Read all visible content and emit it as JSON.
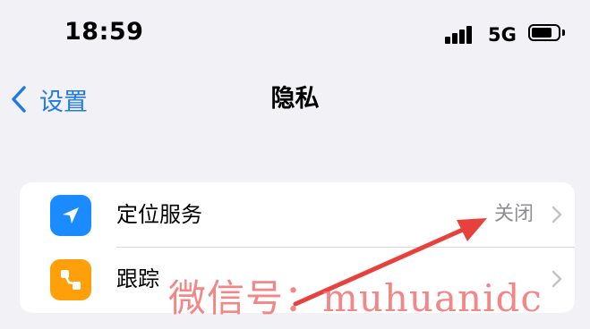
{
  "status_bar": {
    "time": "18:59",
    "network": "5G"
  },
  "nav": {
    "back_label": "设置",
    "title": "隐私"
  },
  "settings": {
    "rows": [
      {
        "label": "定位服务",
        "value": "关闭"
      },
      {
        "label": "跟踪",
        "value": ""
      }
    ]
  },
  "watermark": {
    "text": "微信号：muhuanidc"
  },
  "colors": {
    "accent": "#1f7ae8",
    "location_icon": "#1a8cff",
    "tracking_icon": "#ff9f0a",
    "annotation_arrow": "#e8403c"
  },
  "icons": {
    "back": "chevron-left-icon",
    "location": "location-arrow-icon",
    "tracking": "tracking-icon",
    "row_chevron": "chevron-right-icon"
  }
}
